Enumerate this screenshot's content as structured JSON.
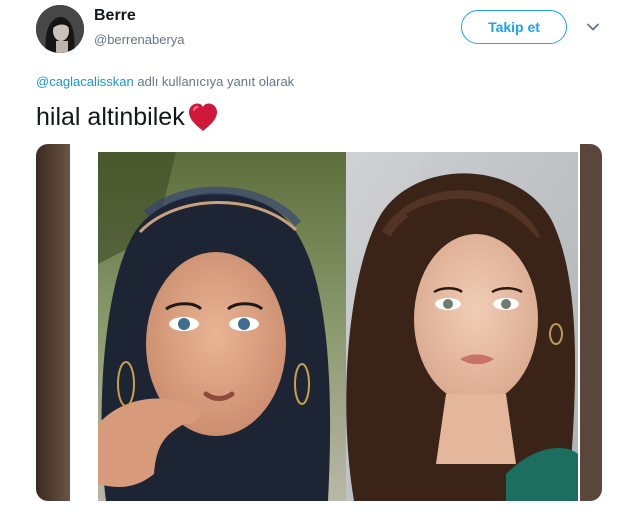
{
  "tweet": {
    "author_name": "Berre",
    "author_handle": "@berrenaberya",
    "follow_label": "Takip et",
    "reply_mention": "@caglacalisskan",
    "reply_suffix": " adlı kullanıcıya yanıt olarak",
    "text": "hilal altinbilek",
    "text_emoji": "heart-emoji"
  },
  "icons": {
    "more": "chevron-down-icon",
    "heart": "red-heart-emoji"
  },
  "colors": {
    "accent": "#1da1f2",
    "mention": "#1b95e0",
    "secondary_text": "#657786",
    "heart": "#d0183a"
  }
}
